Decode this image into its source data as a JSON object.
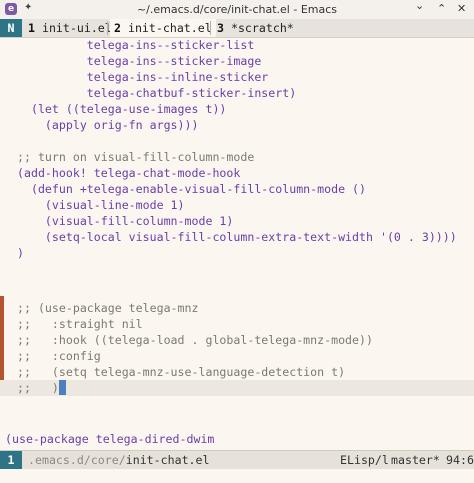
{
  "window": {
    "title": "~/.emacs.d/core/init-chat.el - Emacs",
    "min_label": "⌄",
    "max_label": "⌃",
    "close_label": "✕"
  },
  "tabline": {
    "mode_indicator": "N",
    "tabs": [
      {
        "num": "1",
        "label": " init-ui.el"
      },
      {
        "num": "2",
        "label": " init-chat.el"
      },
      {
        "num": "3",
        "label": " *scratch*"
      }
    ]
  },
  "buffer": {
    "lines": [
      "          telega-ins--sticker-list",
      "          telega-ins--sticker-image",
      "          telega-ins--inline-sticker",
      "          telega-chatbuf-sticker-insert)",
      "  (let ((telega-use-images t))",
      "    (apply orig-fn args)))",
      "",
      ";; turn on visual-fill-column-mode",
      "(add-hook! telega-chat-mode-hook",
      "  (defun +telega-enable-visual-fill-column-mode ()",
      "    (visual-line-mode 1)",
      "    (visual-fill-column-mode 1)",
      "    (setq-local visual-fill-column-extra-text-width '(0 . 3))))",
      ")",
      "",
      "",
      ";; (use-package telega-mnz",
      ";;   :straight nil",
      ";;   :hook ((telega-load . global-telega-mnz-mode))",
      ";;   :config",
      ";;   (setq telega-mnz-use-language-detection t)",
      ";;   )",
      "",
      "",
      "(use-package telega-dired-dwim"
    ]
  },
  "modeline": {
    "window_number": "1",
    "path": " .emacs.d/core/",
    "file": "init-chat.el",
    "major_mode": "ELisp/l",
    "branch": "master*",
    "position": "94:6"
  },
  "colors": {
    "background": "#fbf7f0",
    "accent": "#2d7487",
    "keyword": "#6a3ea8",
    "comment": "#7a7a6f",
    "change_marker": "#b3542e",
    "cursor": "#4a7fc0"
  }
}
